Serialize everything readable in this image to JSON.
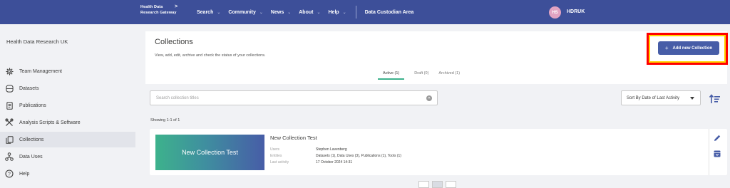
{
  "nav": {
    "logo_line1": "Health Data",
    "logo_line2": "Research Gateway",
    "items": [
      {
        "label": "Search"
      },
      {
        "label": "Community"
      },
      {
        "label": "News"
      },
      {
        "label": "About"
      },
      {
        "label": "Help"
      }
    ],
    "custodian_area": "Data Custodian Area",
    "avatar_initials": "HS",
    "username": "HDRUK"
  },
  "sidebar": {
    "org_name": "Health Data Research UK",
    "items": [
      {
        "label": "Team Management",
        "icon": "gear-icon"
      },
      {
        "label": "Datasets",
        "icon": "database-icon"
      },
      {
        "label": "Publications",
        "icon": "document-icon"
      },
      {
        "label": "Analysis Scripts & Software",
        "icon": "tools-icon"
      },
      {
        "label": "Collections",
        "icon": "collections-icon",
        "active": true
      },
      {
        "label": "Data Uses",
        "icon": "data-uses-icon"
      },
      {
        "label": "Help",
        "icon": "help-icon"
      }
    ]
  },
  "header": {
    "title": "Collections",
    "subtitle": "View, add, edit, archive and check the status of your collections.",
    "add_button": "Add new Collection",
    "tabs": [
      {
        "label": "Active (1)",
        "active": true
      },
      {
        "label": "Draft (0)"
      },
      {
        "label": "Archived (1)"
      }
    ]
  },
  "search": {
    "placeholder": "Search collection titles"
  },
  "sort": {
    "selected": "Sort By Date of Last Activity"
  },
  "results": {
    "showing": "Showing 1-1 of 1"
  },
  "card": {
    "banner_text": "New Collection Test",
    "title": "New Collection Test",
    "fields": [
      {
        "key": "Users",
        "value": "Stephen Lavenberg"
      },
      {
        "key": "Entities",
        "value": "Datasets (1), Data Uses (3), Publications (1), Tools (1)"
      },
      {
        "key": "Last activity",
        "value": "17 October 2024 14:31"
      }
    ]
  },
  "colors": {
    "nav_bg": "#3d4f99",
    "accent_green": "#3db28c",
    "button_blue": "#475da7",
    "highlight_red": "#ff0000",
    "highlight_yellow": "#ffd400"
  }
}
